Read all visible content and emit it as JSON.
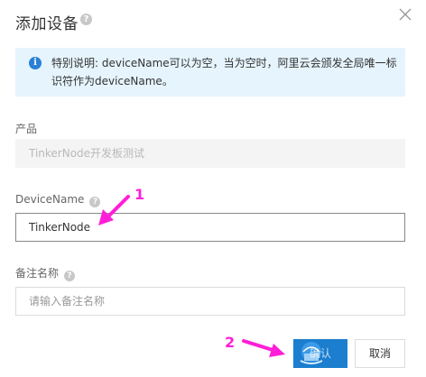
{
  "dialog": {
    "title": "添加设备",
    "title_help_icon": "question-icon",
    "close_icon": "close-icon"
  },
  "notice": {
    "icon": "info-icon",
    "text": "特别说明: deviceName可以为空，当为空时，阿里云会颁发全局唯一标识符作为deviceName。"
  },
  "form": {
    "product_label": "产品",
    "product_value": "TinkerNode开发板测试",
    "device_name_label": "DeviceName",
    "device_name_value": "TinkerNode",
    "remark_label": "备注名称",
    "remark_placeholder": "请输入备注名称"
  },
  "annotations": {
    "step1": "1",
    "step2": "2",
    "color": "#ff1fd8"
  },
  "footer": {
    "confirm_label": "确认",
    "cancel_label": "取消"
  },
  "colors": {
    "primary": "#1b7ecf",
    "notice_bg": "#e6f4fd"
  }
}
